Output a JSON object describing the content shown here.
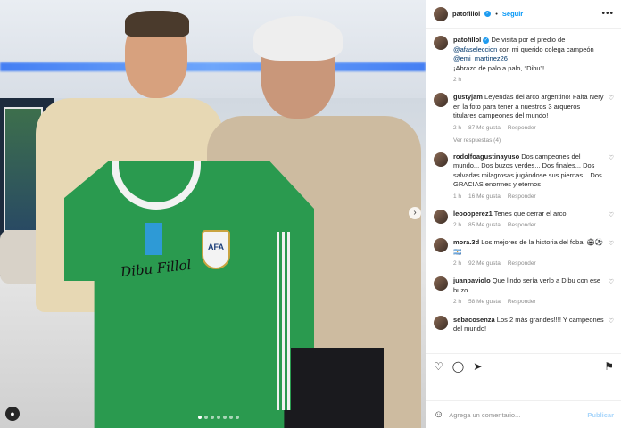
{
  "post": {
    "author": "patofillol",
    "follow_label": "Seguir",
    "more": "•••",
    "caption_prefix": "De visita por el predio de",
    "caption_mention1": "@afaseleccion",
    "caption_mid": "con mi querido colega campeón",
    "caption_mention2": "@emi_martinez26",
    "caption_end": "¡Abrazo de palo a palo, “Dibu”!",
    "caption_time": "2 h"
  },
  "photo": {
    "signature": "Dibu Fillol",
    "crest": "AFA",
    "next_arrow": "›",
    "user_tag_icon": "person-icon",
    "slides": 7,
    "active_slide": 1
  },
  "comments": [
    {
      "user": "gustyjam",
      "text": "Leyendas del arco argentino! Falta Nery en la foto para tener a nuestros 3 arqueros titulares campeones del mundo!",
      "time": "2 h",
      "likes": "87 Me gusta",
      "reply": "Responder"
    },
    {
      "user": "rodolfoagustinayuso",
      "text": "Dos campeones del mundo... Dos buzos verdes... Dos finales... Dos salvadas milagrosas jugándose sus piernas... Dos GRACIAS enormes y eternos",
      "time": "1 h",
      "likes": "16 Me gusta",
      "reply": "Responder"
    },
    {
      "user": "leoooperez1",
      "text": "Tenes que cerrar el arco",
      "time": "2 h",
      "likes": "85 Me gusta",
      "reply": "Responder"
    },
    {
      "user": "mora.3d",
      "text": "Los mejores de la historia del fobal 🏟⚽🇦🇷",
      "time": "2 h",
      "likes": "92 Me gusta",
      "reply": "Responder"
    },
    {
      "user": "juanpaviolo",
      "text": "Que lindo sería verlo a Dibu con ese buzo....",
      "time": "2 h",
      "likes": "58 Me gusta",
      "reply": "Responder"
    },
    {
      "user": "sebacosenza",
      "text": "Los 2 más grandes!!!! Y campeones del mundo!",
      "time": "",
      "likes": "",
      "reply": ""
    }
  ],
  "replies_label": "Ver respuestas (4)",
  "actions": {
    "like": "♡",
    "comment": "◯",
    "share": "➤",
    "save": "⚑"
  },
  "add_comment": {
    "placeholder": "Agrega un comentario...",
    "publish": "Publicar",
    "emoji": "☺"
  },
  "colors": {
    "accent": "#0095f6",
    "verified": "#1d9bf0",
    "jersey": "#2a9a4f"
  }
}
